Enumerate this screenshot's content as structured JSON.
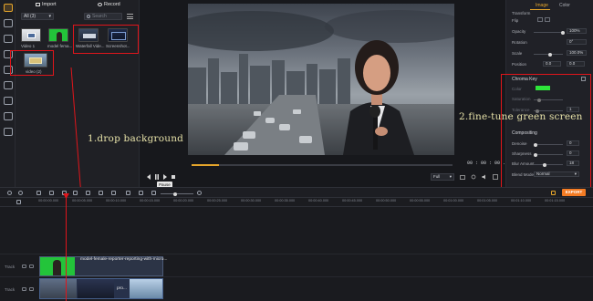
{
  "media": {
    "import_label": "Import",
    "record_label": "Record",
    "filter_value": "All (3)",
    "search_placeholder": "Search",
    "items": [
      {
        "label": "Video 1"
      },
      {
        "label": "model fema..."
      },
      {
        "label": "Waterfall Vide..."
      },
      {
        "label": "Screenshot..."
      }
    ],
    "folder_label": "video (2)"
  },
  "player": {
    "timecode": "00 : 00 : 00 . 264",
    "tooltip": "Pause",
    "fit_value": "Full"
  },
  "properties": {
    "tabs": [
      "Image",
      "Color"
    ],
    "transform_label": "Transform",
    "rows": [
      {
        "label": "Flip",
        "value": ""
      },
      {
        "label": "Opacity",
        "value": "100%"
      },
      {
        "label": "Rotation",
        "value": "0°"
      },
      {
        "label": "Scale",
        "value": "100.0%"
      },
      {
        "label": "Position",
        "value_x": "0.0",
        "value_y": "0.0"
      }
    ],
    "chroma_key": {
      "title": "Chroma Key",
      "color_label": "Color",
      "color_value": "#2ee63a",
      "saturation_label": "Saturation",
      "tolerance_label": "Tolerance",
      "tolerance_value": "1"
    },
    "compositing": {
      "title": "Compositing",
      "rows": [
        {
          "label": "Denoise",
          "value": "0"
        },
        {
          "label": "Sharpness",
          "value": "0"
        },
        {
          "label": "Blur Amount",
          "value": "18"
        }
      ],
      "blend_label": "Blend Mode",
      "blend_value": "Normal"
    }
  },
  "toolbar": {
    "export_label": "EXPORT"
  },
  "timeline": {
    "ruler": [
      "00:00:00.000",
      "00:00:05.000",
      "00:00:10.000",
      "00:00:15.000",
      "00:00:20.000",
      "00:00:25.000",
      "00:00:30.000",
      "00:00:35.000",
      "00:00:40.000",
      "00:00:45.000",
      "00:00:50.000",
      "00:00:55.000",
      "00:01:00.000",
      "00:01:05.000",
      "00:01:10.000",
      "00:01:15.000"
    ],
    "tracks": [
      {
        "label": "Track"
      },
      {
        "label": "Track"
      }
    ],
    "clip_top_name": "model-female-reporter-reporting-with-micro...",
    "clip_bottom_name": "pro..."
  },
  "annotations": {
    "drop": "1.drop background",
    "tune": "2.fine-tune green screen"
  },
  "colors": {
    "accent": "#e5a52b",
    "highlight_box": "#e0151b",
    "export": "#f47c24",
    "chroma": "#2ee63a"
  }
}
